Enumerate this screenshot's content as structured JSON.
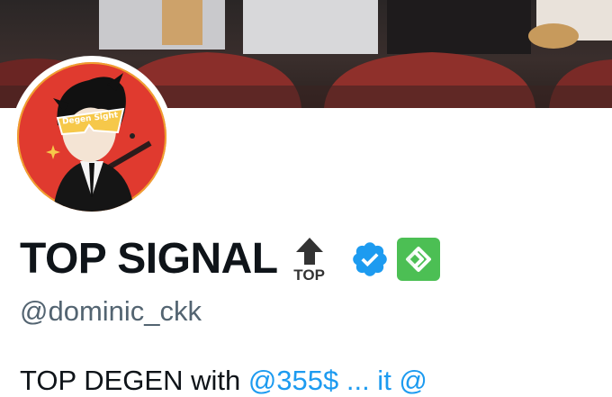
{
  "profile": {
    "display_name": "TOP SIGNAL",
    "top_emoji_text": "TOP",
    "handle": "@dominic_ckk",
    "bio_text": "TOP DEGEN with ",
    "bio_link": "@355$ ... it @"
  },
  "avatar": {
    "glasses_text": "Degen Sight"
  },
  "icons": {
    "verified": "verified-check-icon",
    "app": "app-logo-icon",
    "top": "top-arrow-emoji-icon"
  },
  "colors": {
    "verified_blue": "#1d9bf0",
    "app_green": "#4cbf54",
    "avatar_red": "#e03a2f",
    "text_dark": "#0f1419",
    "handle_gray": "#536471"
  }
}
